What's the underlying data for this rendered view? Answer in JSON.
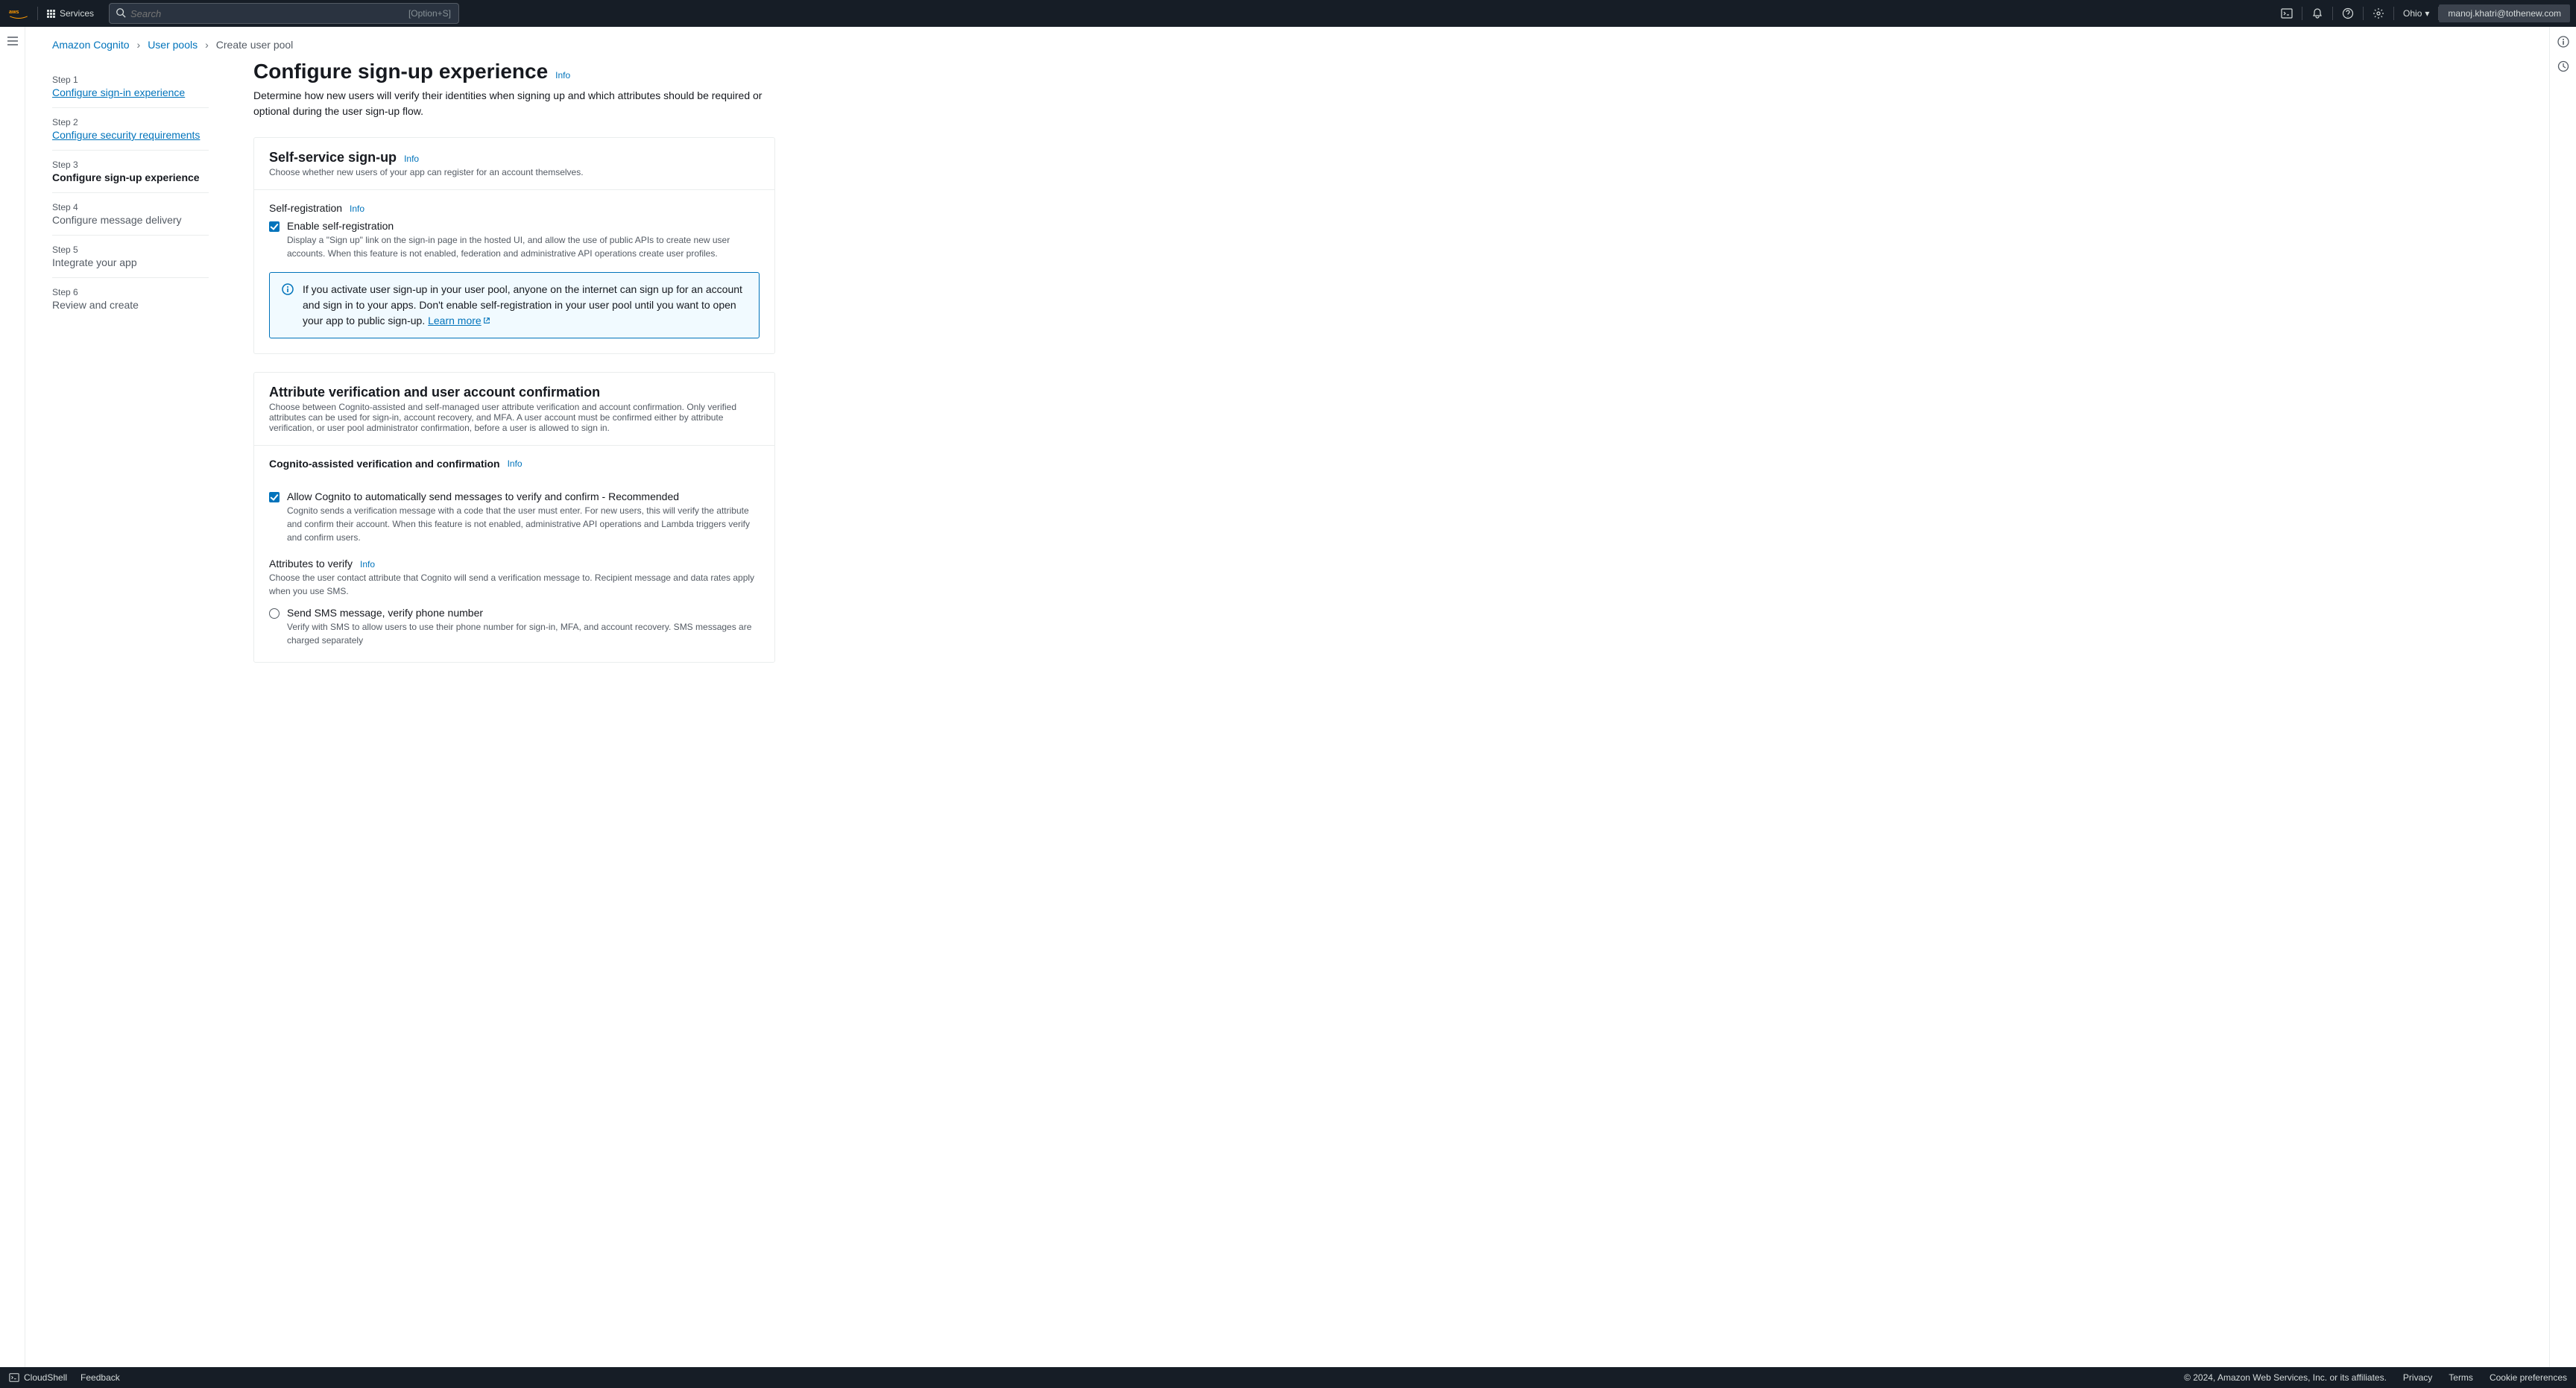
{
  "nav": {
    "services_label": "Services",
    "search_placeholder": "Search",
    "search_hotkey": "[Option+S]",
    "region": "Ohio",
    "account": "manoj.khatri@tothenew.com"
  },
  "breadcrumb": {
    "service": "Amazon Cognito",
    "pool_list": "User pools",
    "current": "Create user pool"
  },
  "wizard": {
    "steps": [
      {
        "n": "Step 1",
        "title": "Configure sign-in experience",
        "kind": "link"
      },
      {
        "n": "Step 2",
        "title": "Configure security requirements",
        "kind": "link"
      },
      {
        "n": "Step 3",
        "title": "Configure sign-up experience",
        "kind": "current"
      },
      {
        "n": "Step 4",
        "title": "Configure message delivery",
        "kind": "future"
      },
      {
        "n": "Step 5",
        "title": "Integrate your app",
        "kind": "future"
      },
      {
        "n": "Step 6",
        "title": "Review and create",
        "kind": "future"
      }
    ]
  },
  "page": {
    "title": "Configure sign-up experience",
    "info": "Info",
    "desc": "Determine how new users will verify their identities when signing up and which attributes should be required or optional during the user sign-up flow."
  },
  "panel1": {
    "title": "Self-service sign-up",
    "info": "Info",
    "subtitle": "Choose whether new users of your app can register for an account themselves.",
    "section": "Self-registration",
    "section_info": "Info",
    "checkbox_label": "Enable self-registration",
    "checkbox_desc": "Display a \"Sign up\" link on the sign-in page in the hosted UI, and allow the use of public APIs to create new user accounts. When this feature is not enabled, federation and administrative API operations create user profiles.",
    "callout_text": "If you activate user sign-up in your user pool, anyone on the internet can sign up for an account and sign in to your apps. Don't enable self-registration in your user pool until you want to open your app to public sign-up. ",
    "callout_link": "Learn more"
  },
  "panel2": {
    "title": "Attribute verification and user account confirmation",
    "subtitle": "Choose between Cognito-assisted and self-managed user attribute verification and account confirmation. Only verified attributes can be used for sign-in, account recovery, and MFA. A user account must be confirmed either by attribute verification, or user pool administrator confirmation, before a user is allowed to sign in.",
    "assisted_heading": "Cognito-assisted verification and confirmation",
    "assisted_info": "Info",
    "allow_label": "Allow Cognito to automatically send messages to verify and confirm - Recommended",
    "allow_desc": "Cognito sends a verification message with a code that the user must enter. For new users, this will verify the attribute and confirm their account. When this feature is not enabled, administrative API operations and Lambda triggers verify and confirm users.",
    "attrs_heading": "Attributes to verify",
    "attrs_info": "Info",
    "attrs_desc": "Choose the user contact attribute that Cognito will send a verification message to. Recipient message and data rates apply when you use SMS.",
    "radio1_label": "Send SMS message, verify phone number",
    "radio1_desc": "Verify with SMS to allow users to use their phone number for sign-in, MFA, and account recovery. SMS messages are charged separately"
  },
  "footer": {
    "cloudshell": "CloudShell",
    "feedback": "Feedback",
    "copyright": "© 2024, Amazon Web Services, Inc. or its affiliates.",
    "privacy": "Privacy",
    "terms": "Terms",
    "cookies": "Cookie preferences"
  }
}
